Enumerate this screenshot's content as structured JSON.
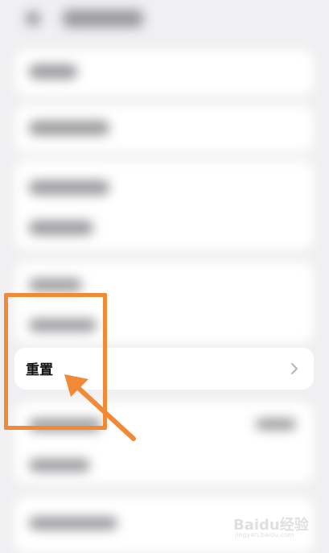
{
  "reset": {
    "label": "重置"
  },
  "watermark": {
    "brand": "Baidu经验",
    "domain": "jingyan.baidu.com"
  },
  "colors": {
    "accent": "#f08a37",
    "background": "#f0f0f2"
  }
}
